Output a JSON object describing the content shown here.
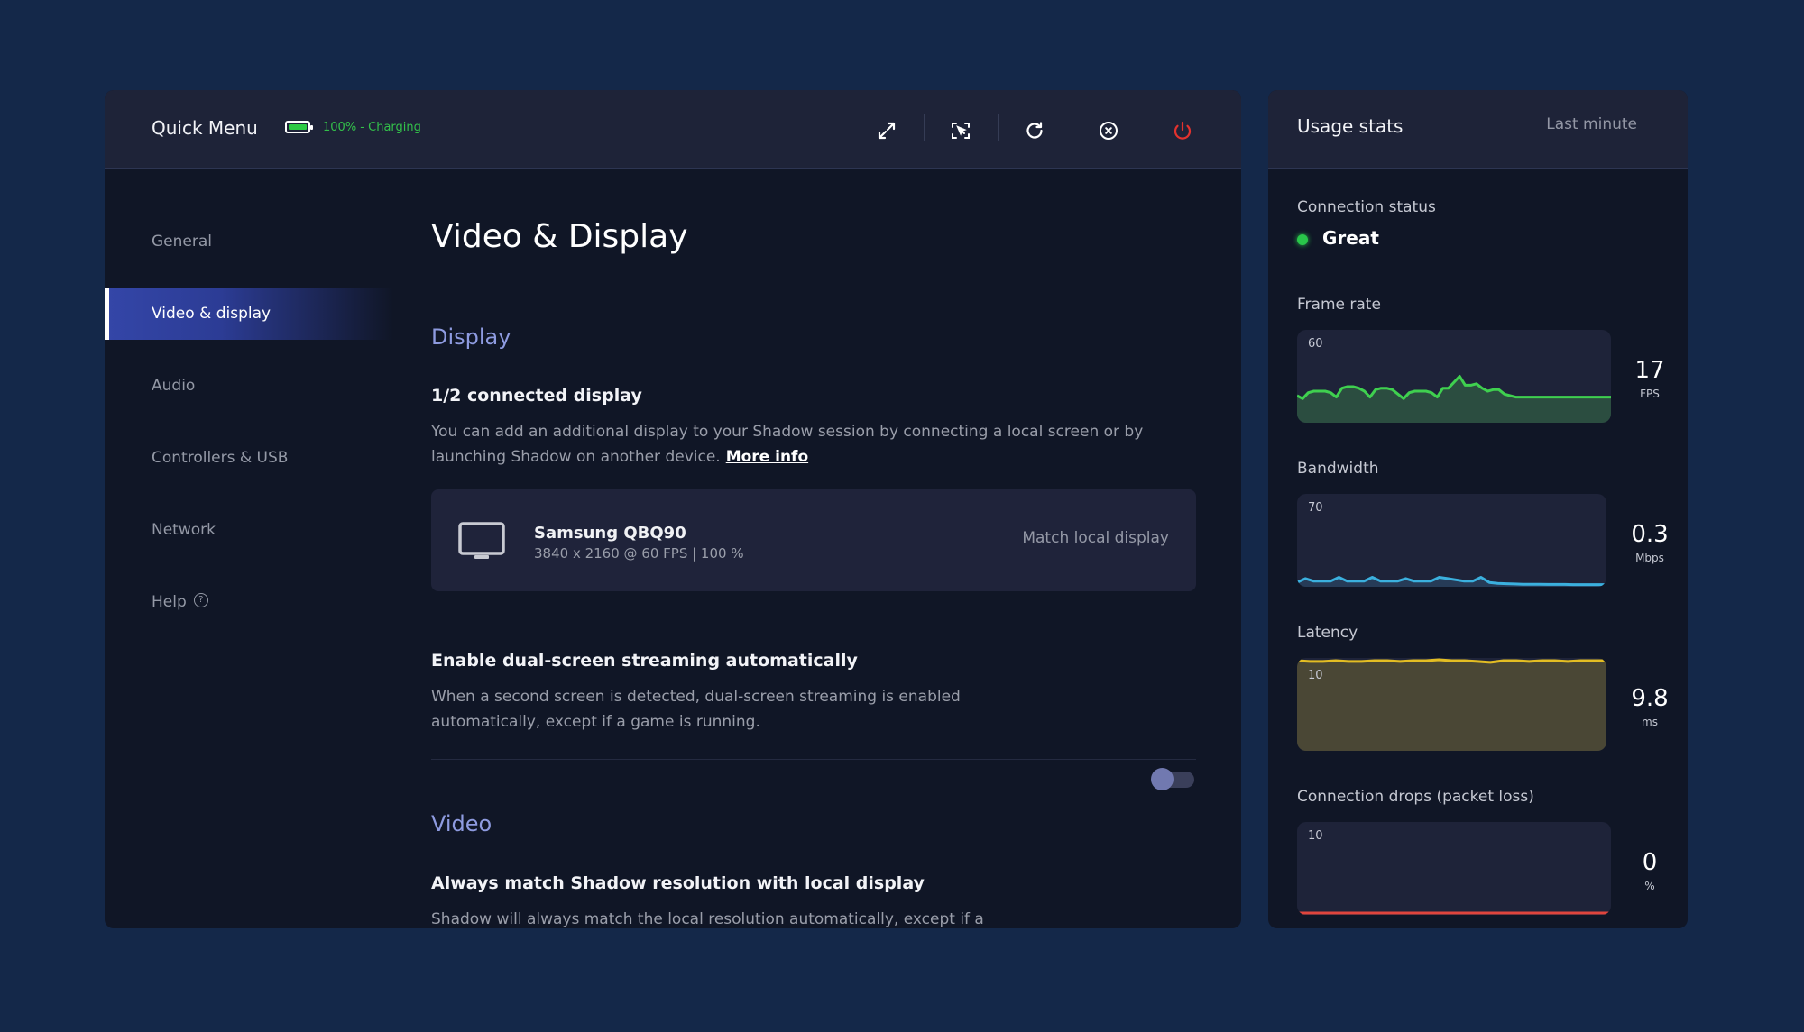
{
  "header": {
    "title": "Quick Menu",
    "battery_text": "100% - Charging",
    "battery_level_percent": 100,
    "toolbar": [
      {
        "name": "fullscreen",
        "icon": "expand-arrows-icon"
      },
      {
        "name": "cursor-lock",
        "icon": "cursor-frame-icon"
      },
      {
        "name": "restart",
        "icon": "refresh-icon"
      },
      {
        "name": "disconnect",
        "icon": "close-circle-icon"
      },
      {
        "name": "power",
        "icon": "power-icon"
      }
    ]
  },
  "sidebar": {
    "items": [
      {
        "label": "General",
        "active": false
      },
      {
        "label": "Video & display",
        "active": true
      },
      {
        "label": "Audio",
        "active": false
      },
      {
        "label": "Controllers & USB",
        "active": false
      },
      {
        "label": "Network",
        "active": false
      },
      {
        "label": "Help",
        "active": false,
        "icon": "help-circle-icon"
      }
    ]
  },
  "main": {
    "page_title": "Video & Display",
    "display_section": {
      "heading": "Display",
      "connected_title": "1/2 connected display",
      "connected_desc": "You can add an additional display to your Shadow session by connecting a local screen or by launching Shadow on another device.",
      "more_info_label": "More info",
      "monitor": {
        "name": "Samsung QBQ90",
        "spec": "3840 x 2160 @ 60 FPS  |  100 %",
        "action_label": "Match local display"
      },
      "dual_screen": {
        "title": "Enable dual-screen streaming automatically",
        "desc": "When a second screen is detected, dual-screen streaming is enabled automatically, except if a game is running.",
        "enabled": false
      }
    },
    "video_section": {
      "heading": "Video",
      "match_resolution": {
        "title": "Always match Shadow resolution with local display",
        "desc": "Shadow will always match the local resolution automatically, except if a",
        "enabled": true
      }
    }
  },
  "usage": {
    "title": "Usage stats",
    "range_label": "Last minute",
    "connection_status_label": "Connection status",
    "connection_status": "Great",
    "status_color": "#29c64a"
  },
  "chart_data": [
    {
      "type": "area",
      "title": "Frame rate",
      "ymax_label": "60",
      "ylim": [
        0,
        60
      ],
      "current_value": "17",
      "unit": "FPS",
      "color": "#3fd04f",
      "fill": "#2b4d40",
      "values": [
        17,
        15,
        19,
        20,
        20,
        20,
        19,
        16,
        22,
        23,
        23,
        22,
        20,
        16,
        21,
        22,
        22,
        21,
        18,
        15,
        19,
        20,
        20,
        20,
        19,
        16,
        22,
        22,
        26,
        30,
        24,
        24,
        25,
        22,
        20,
        21,
        21,
        18,
        17,
        16,
        16,
        16,
        16,
        16,
        16,
        16,
        16,
        16,
        16,
        16,
        16,
        16,
        16,
        16,
        16,
        16,
        16
      ]
    },
    {
      "type": "area",
      "title": "Bandwidth",
      "ymax_label": "70",
      "ylim": [
        0,
        70
      ],
      "current_value": "0.3",
      "unit": "Mbps",
      "color": "#3bb0de",
      "fill": "#263b57",
      "values": [
        2,
        5,
        3,
        3,
        3,
        6,
        3,
        3,
        3,
        6,
        3,
        3,
        3,
        5,
        3,
        3,
        3,
        6,
        5,
        4,
        3,
        3,
        6,
        2,
        1.3,
        1,
        0.8,
        0.6,
        0.5,
        0.5,
        0.4,
        0.4,
        0.4,
        0.3,
        0.3,
        0.3,
        0.3,
        0.3
      ]
    },
    {
      "type": "area",
      "title": "Latency",
      "ymax_label": "10",
      "ylim": [
        0,
        10.4
      ],
      "current_value": "9.8",
      "unit": "ms",
      "color": "#e3bd23",
      "fill": "#4a4735",
      "values": [
        10.3,
        10.2,
        10.2,
        10.3,
        10.2,
        10.2,
        10.3,
        10.3,
        10.2,
        10.3,
        10.3,
        10.4,
        10.3,
        10.3,
        10.2,
        10.1,
        10.3,
        10.3,
        10.2,
        10.3,
        10.3,
        10.2,
        10.3,
        10.3,
        10.3
      ]
    },
    {
      "type": "area",
      "title": "Connection drops (packet loss)",
      "ymax_label": "10",
      "ylim": [
        0,
        10
      ],
      "current_value": "0",
      "unit": "%",
      "color": "#e0453d",
      "fill": "#1e2339",
      "values": [
        0,
        0,
        0,
        0,
        0,
        0,
        0,
        0,
        0,
        0,
        0,
        0,
        0,
        0,
        0,
        0,
        0,
        0,
        0,
        0
      ]
    }
  ]
}
